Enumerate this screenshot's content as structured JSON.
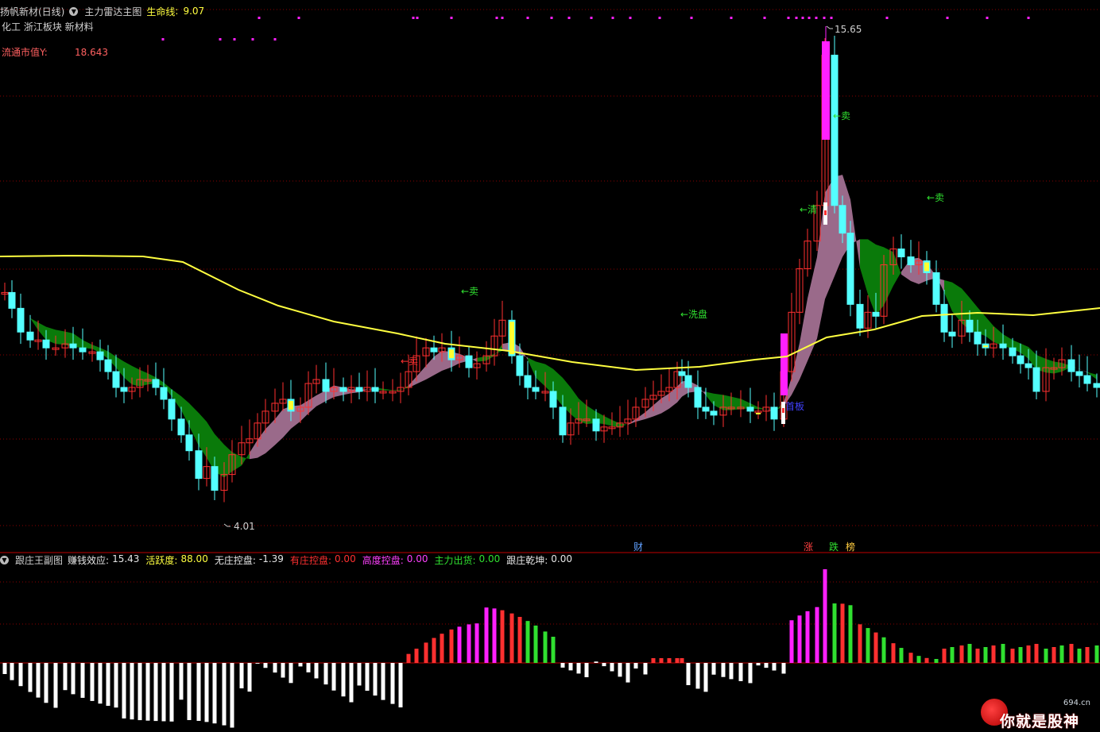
{
  "main_panel": {
    "stock_name": "扬帆新材(日线)",
    "indicator_name": "主力雷达主图",
    "lifeline_label": "生命线",
    "lifeline_value": "9.07",
    "sector_tags": "化工 浙江板块 新材料",
    "market_cap_label": "流通市值Y:",
    "market_cap_value": "18.643",
    "high_label": "15.65",
    "low_label": "4.01",
    "annotations": {
      "sell1": "←卖",
      "sell2": "←卖",
      "sell3": "←卖",
      "sell4": "←卖",
      "wash": "←洗盘",
      "clear": "←清",
      "first_board": "首板"
    },
    "events": {
      "cai": "财",
      "zhang": "涨",
      "die": "跌",
      "bang": "榜"
    }
  },
  "sub_panel": {
    "indicator_name": "跟庄王副图",
    "items": [
      {
        "label": "赚钱效应:",
        "value": "15.43",
        "color": "#e6e6e6"
      },
      {
        "label": "活跃度:",
        "value": "88.00",
        "color": "#ffff40"
      },
      {
        "label": "无庄控盘:",
        "value": "-1.39",
        "color": "#e6e6e6"
      },
      {
        "label": "有庄控盘:",
        "value": "0.00",
        "color": "#ff3030"
      },
      {
        "label": "高度控盘:",
        "value": "0.00",
        "color": "#ff40ff"
      },
      {
        "label": "主力出货:",
        "value": "0.00",
        "color": "#30e030"
      },
      {
        "label": "跟庄乾坤:",
        "value": "0.00",
        "color": "#e6e6e6"
      }
    ]
  },
  "watermark": {
    "site": "694.cn",
    "slogan": "你就是股神"
  },
  "colors": {
    "up": "#ff3030",
    "down": "#54ffff",
    "lifeline": "#ffff40",
    "band_green": "#0a7a0a",
    "band_pink": "#9a6a8a",
    "magenta": "#ff20ff",
    "grid": "#8a0000"
  }
}
